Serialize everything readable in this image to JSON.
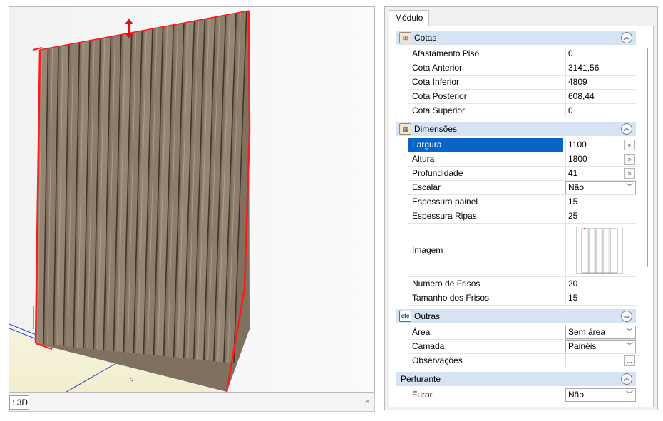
{
  "viewport": {
    "tab_label": ": 3D",
    "close_glyph": "×"
  },
  "panel": {
    "tab_label": "Módulo",
    "sections": {
      "cotas": {
        "icon": "ruler-icon",
        "title": "Cotas",
        "rows": [
          {
            "label": "Afastamento Piso",
            "value": "0"
          },
          {
            "label": "Cota Anterior",
            "value": "3141,56"
          },
          {
            "label": "Cota Inferior",
            "value": "4809"
          },
          {
            "label": "Cota Posterior",
            "value": "608,44"
          },
          {
            "label": "Cota Superior",
            "value": "0"
          }
        ]
      },
      "dimensoes": {
        "icon": "dimensions-icon",
        "title": "Dimensões",
        "rows": [
          {
            "label": "Largura",
            "value": "1100",
            "button": "»"
          },
          {
            "label": "Altura",
            "value": "1800",
            "button": "»"
          },
          {
            "label": "Profundidade",
            "value": "41",
            "button": "»"
          },
          {
            "label": "Escalar",
            "value": "Não"
          },
          {
            "label": "Espessura painel",
            "value": "15"
          },
          {
            "label": "Espessura Ripas",
            "value": "25"
          },
          {
            "label": "Imagem",
            "value": ""
          },
          {
            "label": "Numero de Frisos",
            "value": "20"
          },
          {
            "label": "Tamanho dos Frisos",
            "value": "15"
          }
        ]
      },
      "outras": {
        "icon": "etc-icon",
        "icon_text": "etc",
        "title": "Outras",
        "rows": [
          {
            "label": "Área",
            "value": "Sem área"
          },
          {
            "label": "Camada",
            "value": "Painéis"
          },
          {
            "label": "Observações",
            "value": "",
            "button": "..."
          }
        ]
      },
      "perfurante": {
        "title": "Perfurante",
        "rows": [
          {
            "label": "Furar",
            "value": "Não"
          }
        ]
      }
    },
    "collapse_glyph": "︽",
    "colors": {
      "section_header": "#d6e3f3",
      "selected_row": "#0a64c8",
      "wood": "#8a7a66",
      "edge_highlight": "#ff0000"
    }
  }
}
